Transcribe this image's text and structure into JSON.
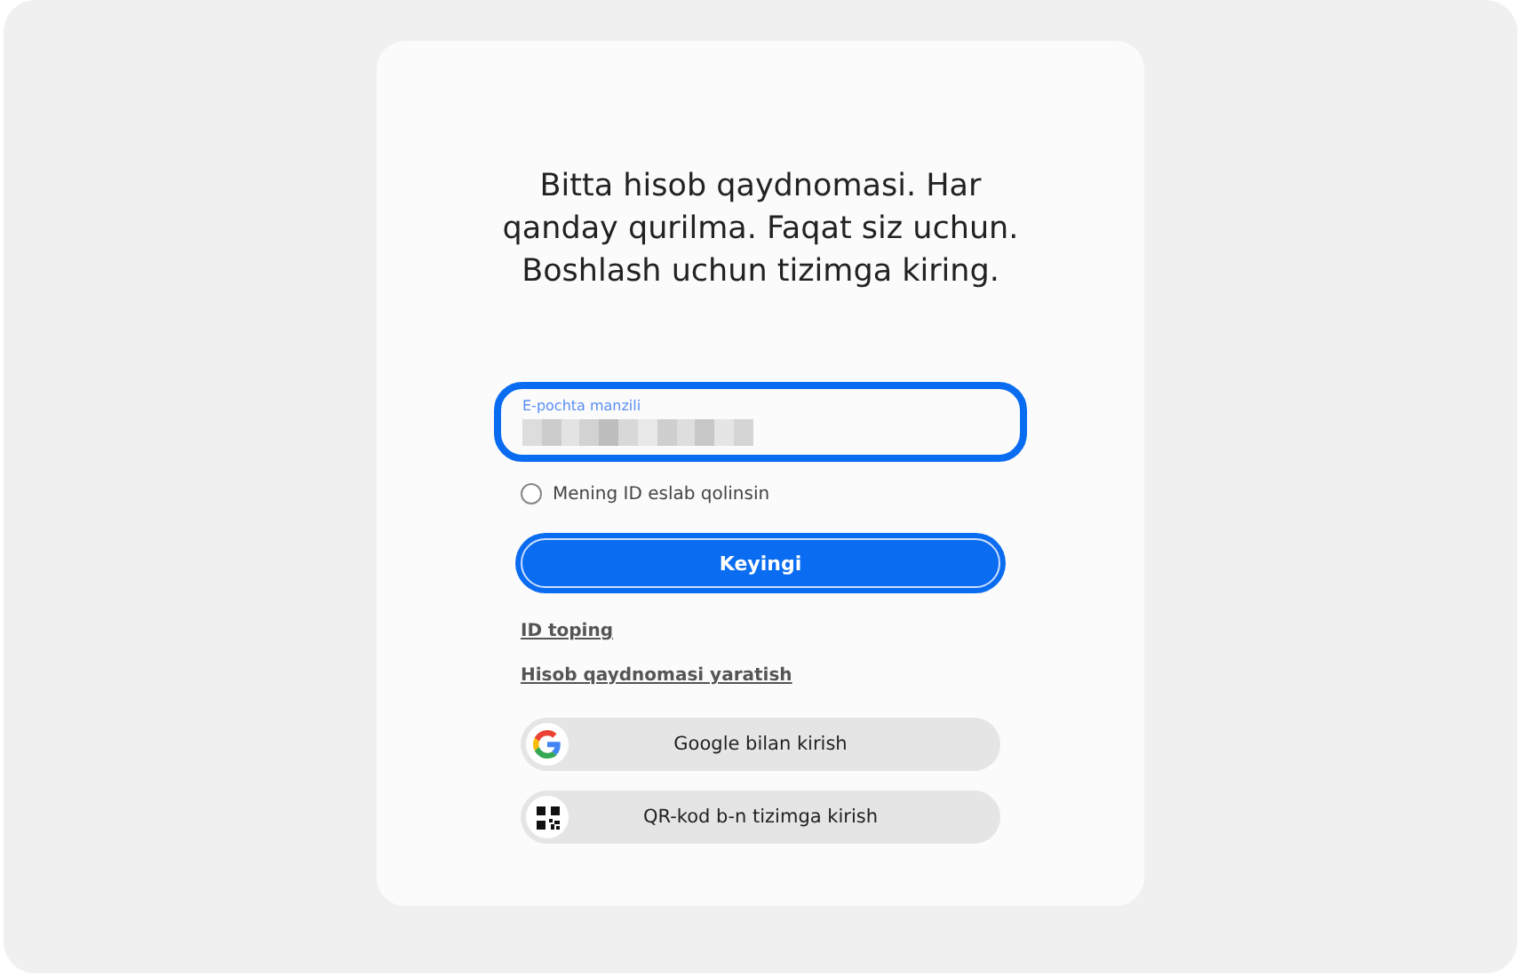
{
  "heading": "Bitta hisob qaydnomasi. Har qanday qurilma. Faqat siz uchun. Boshlash uchun tizimga kiring.",
  "email_field": {
    "label": "E-pochta manzili",
    "focused": true
  },
  "remember_id": {
    "label": "Mening ID eslab qolinsin",
    "checked": false
  },
  "next_button": {
    "label": "Keyingi"
  },
  "links": [
    "ID toping",
    "Hisob qaydnomasi yaratish"
  ],
  "sign_in_options": [
    {
      "kind": "google",
      "label": "Google bilan kirish"
    },
    {
      "kind": "qr",
      "label": "QR-kod b-n tizimga kirish"
    }
  ]
}
